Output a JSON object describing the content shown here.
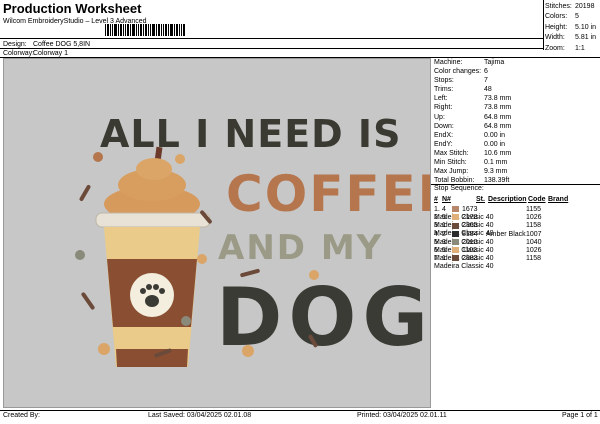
{
  "header": {
    "title": "Production Worksheet",
    "subtitle": "Wilcom EmbroideryStudio – Level 3 Advanced",
    "design_label": "Design:",
    "design_value": "Coffee DOG 5,8IN",
    "colorway_label": "Colorway:",
    "colorway_value": "Colorway 1"
  },
  "stats": [
    {
      "label": "Stitches:",
      "value": "20198"
    },
    {
      "label": "Colors:",
      "value": "5"
    },
    {
      "label": "Height:",
      "value": "5.10 in"
    },
    {
      "label": "Width:",
      "value": "5.81 in"
    },
    {
      "label": "Zoom:",
      "value": "1:1"
    }
  ],
  "machine_info": [
    {
      "label": "Machine:",
      "value": "Tajima"
    },
    {
      "label": "Color changes:",
      "value": "6"
    },
    {
      "label": "Stops:",
      "value": "7"
    },
    {
      "label": "Trims:",
      "value": "48"
    },
    {
      "label": "Left:",
      "value": "73.8 mm"
    },
    {
      "label": "Right:",
      "value": "73.8 mm"
    },
    {
      "label": "Up:",
      "value": "64.8 mm"
    },
    {
      "label": "Down:",
      "value": "64.8 mm"
    },
    {
      "label": "EndX:",
      "value": "0.00 in"
    },
    {
      "label": "EndY:",
      "value": "0.00 in"
    },
    {
      "label": "Max Stitch:",
      "value": "10.6 mm"
    },
    {
      "label": "Min Stitch:",
      "value": "0.1 mm"
    },
    {
      "label": "Max Jump:",
      "value": "9.3 mm"
    },
    {
      "label": "Total Bobbin:",
      "value": "138.39ft"
    }
  ],
  "stop_sequence": {
    "title": "Stop Sequence:",
    "headers": [
      "#",
      "N#",
      "St.",
      "Description",
      "Code",
      "Brand"
    ],
    "rows": [
      {
        "n": "1.",
        "needle": "4",
        "color": "#b8866a",
        "st": "1673",
        "desc": "",
        "code": "1155",
        "brand": "Madeira Classic 40"
      },
      {
        "n": "2.",
        "needle": "5",
        "color": "#e0b07a",
        "st": "2178",
        "desc": "",
        "code": "1026",
        "brand": "Madeira Classic 40"
      },
      {
        "n": "3.",
        "needle": "1",
        "color": "#6b4a3a",
        "st": "2365",
        "desc": "",
        "code": "1158",
        "brand": "Madeira Classic 40"
      },
      {
        "n": "4.",
        "needle": "2",
        "color": "#2b2b2b",
        "st": "8184",
        "desc": "Amber Black",
        "code": "1007",
        "brand": "Madeira Classic 40"
      },
      {
        "n": "5.",
        "needle": "3",
        "color": "#8a8a7a",
        "st": "2010",
        "desc": "",
        "code": "1040",
        "brand": "Madeira Classic 40"
      },
      {
        "n": "6.",
        "needle": "5",
        "color": "#e0b07a",
        "st": "1103",
        "desc": "",
        "code": "1026",
        "brand": "Madeira Classic 40"
      },
      {
        "n": "7.",
        "needle": "1",
        "color": "#6b4a3a",
        "st": "2883",
        "desc": "",
        "code": "1158",
        "brand": "Madeira Classic 40"
      }
    ]
  },
  "design": {
    "line1": "ALL I NEED IS",
    "line2": "COFFEE",
    "line3": "AND MY",
    "line4": "DOG"
  },
  "footer": {
    "created_by": "Created By:",
    "last_saved": "Last Saved: 03/04/2025 02.01.08",
    "printed": "Printed: 03/04/2025 02.01.11",
    "page": "Page 1 of 1"
  }
}
